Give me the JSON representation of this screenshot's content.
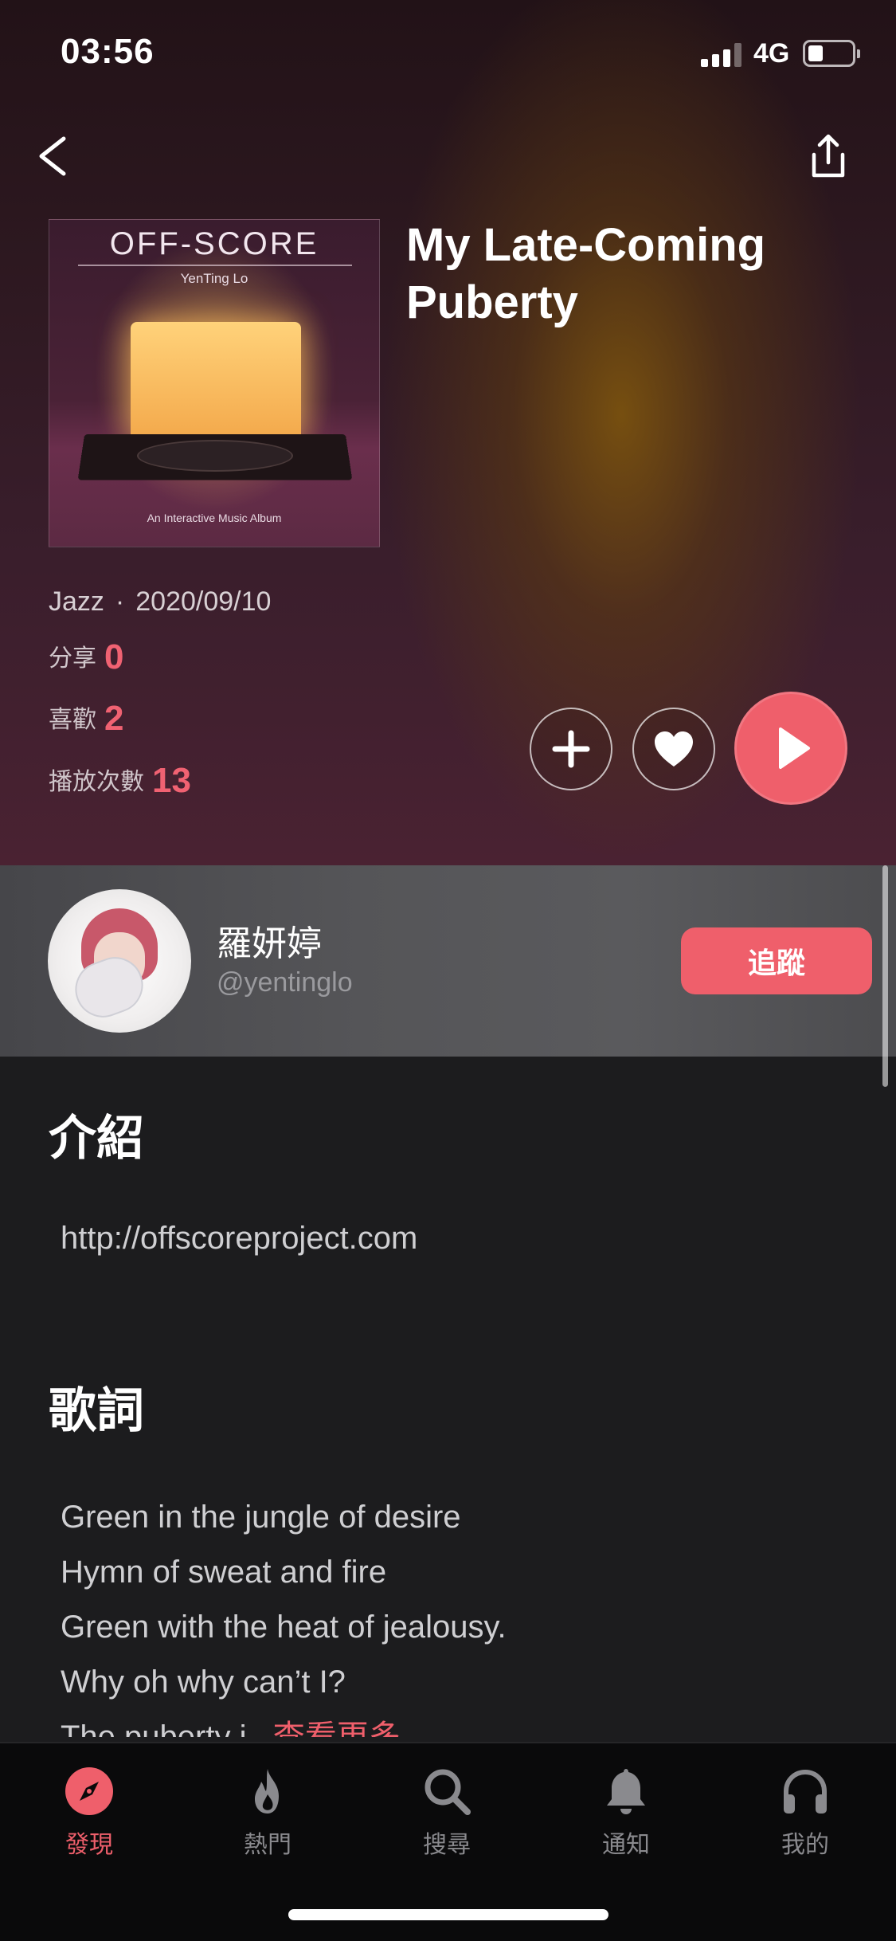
{
  "status_bar": {
    "time": "03:56",
    "network": "4G"
  },
  "song": {
    "title": "My Late-Coming Puberty",
    "genre": "Jazz",
    "separator": "·",
    "date": "2020/09/10",
    "cover": {
      "title": "OFF-SCORE",
      "artist": "YenTing Lo",
      "subtitle": "An Interactive Music Album"
    }
  },
  "stats": {
    "share_label": "分享",
    "share_count": "0",
    "like_label": "喜歡",
    "like_count": "2",
    "plays_label": "播放次數",
    "plays_count": "13"
  },
  "artist": {
    "name": "羅妍婷",
    "handle": "@yentinglo",
    "follow_label": "追蹤"
  },
  "intro": {
    "title": "介紹",
    "link": "http://offscoreproject.com"
  },
  "lyrics": {
    "title": "歌詞",
    "lines": [
      "Green in the jungle of desire",
      "Hymn of sweat and fire",
      "Green with the heat of jealousy.",
      "Why oh why can’t I?"
    ],
    "truncated_line": "The puberty i...",
    "more_label": "查看更多"
  },
  "tabs": [
    {
      "label": "發現",
      "icon": "compass-icon",
      "active": true
    },
    {
      "label": "熱門",
      "icon": "flame-icon",
      "active": false
    },
    {
      "label": "搜尋",
      "icon": "search-icon",
      "active": false
    },
    {
      "label": "通知",
      "icon": "bell-icon",
      "active": false
    },
    {
      "label": "我的",
      "icon": "headphones-icon",
      "active": false
    }
  ],
  "colors": {
    "accent": "#ef5f6b",
    "background": "#1c1c1e",
    "tabbar": "#0a0a0b"
  }
}
